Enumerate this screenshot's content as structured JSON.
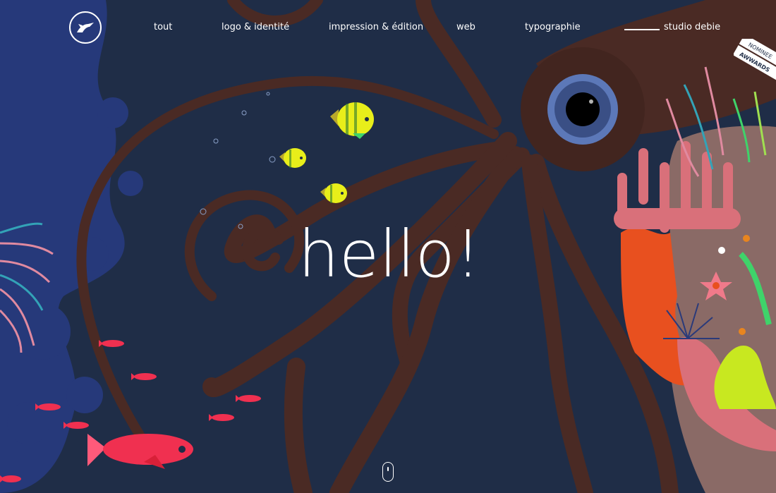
{
  "colors": {
    "background": "#1f2d47",
    "squid": "#4a2a24",
    "coral_blue": "#26397a",
    "coral_orange": "#e8501f",
    "coral_pink": "#d9707a",
    "fish_yellow": "#e8ee1a",
    "fish_red": "#f03050",
    "text": "#ffffff"
  },
  "nav": {
    "logo_icon": "studio-logo-icon",
    "items": [
      {
        "label": "tout"
      },
      {
        "label": "logo & identité"
      },
      {
        "label": "impression & édition"
      },
      {
        "label": "web"
      },
      {
        "label": "typographie"
      }
    ],
    "studio_label": "studio debie"
  },
  "hero": {
    "headline": "hello!"
  },
  "badge": {
    "line1": "NOMINEE",
    "line2": "AWWARDS"
  },
  "scroll_icon": "mouse-scroll-icon"
}
